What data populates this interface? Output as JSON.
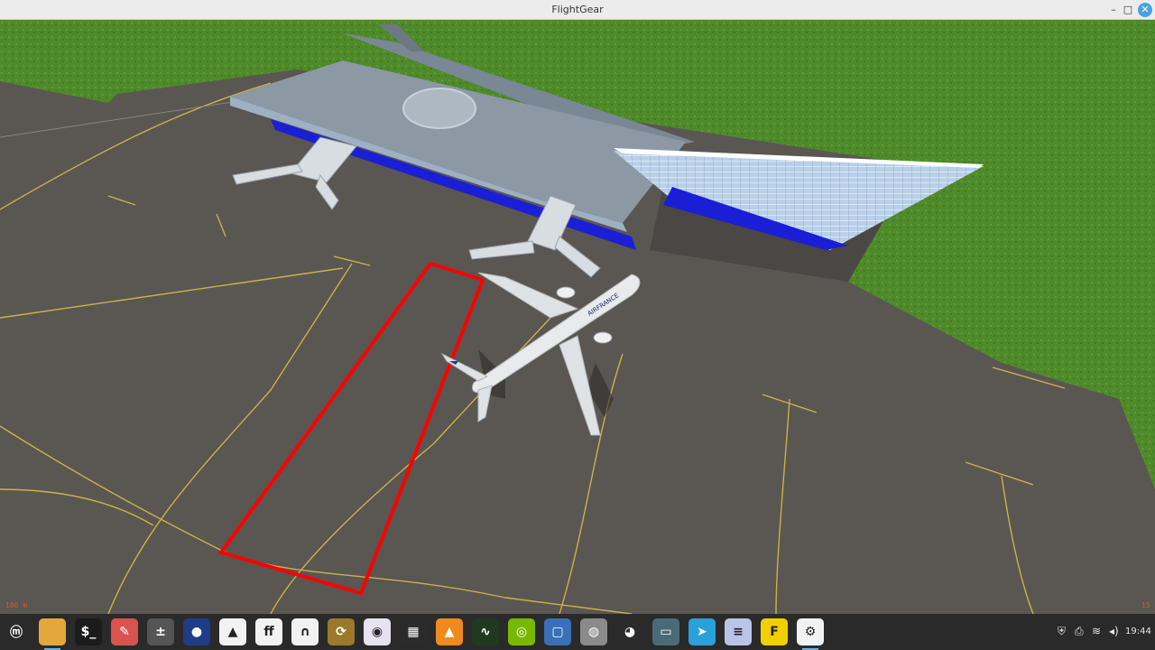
{
  "window": {
    "title": "FlightGear"
  },
  "hud": {
    "bottom_left": "106 m",
    "bottom_right": "15"
  },
  "airliner": {
    "livery": "AIRFRANCE"
  },
  "taskbar": {
    "apps": [
      {
        "name": "menu-icon",
        "glyph": "ⓜ",
        "bg": "#2a2a2a"
      },
      {
        "name": "files-icon",
        "glyph": "",
        "bg": "#e3a73b"
      },
      {
        "name": "terminal-icon",
        "glyph": "$_",
        "bg": "#1b1b1b"
      },
      {
        "name": "gimp-icon",
        "glyph": "✎",
        "bg": "#d9534f"
      },
      {
        "name": "calculator-icon",
        "glyph": "±",
        "bg": "#555555"
      },
      {
        "name": "vpn-icon",
        "glyph": "●",
        "bg": "#1f3c88"
      },
      {
        "name": "inkscape-icon",
        "glyph": "▲",
        "bg": "#f2f2f2"
      },
      {
        "name": "fontforge-icon",
        "glyph": "ff",
        "bg": "#f2f2f2"
      },
      {
        "name": "synaptic-icon",
        "glyph": "∩",
        "bg": "#f2f2f2"
      },
      {
        "name": "update-manager-icon",
        "glyph": "⟳",
        "bg": "#9a7a2a"
      },
      {
        "name": "camera-icon",
        "glyph": "◉",
        "bg": "#e7e2ef"
      },
      {
        "name": "video-editor-icon",
        "glyph": "▦",
        "bg": "#2b2b2b"
      },
      {
        "name": "vlc-icon",
        "glyph": "▲",
        "bg": "#f08a1c"
      },
      {
        "name": "system-monitor-icon",
        "glyph": "∿",
        "bg": "#1f3a1f"
      },
      {
        "name": "nvidia-icon",
        "glyph": "◎",
        "bg": "#76b900"
      },
      {
        "name": "virtualbox-icon",
        "glyph": "▢",
        "bg": "#3a70b8"
      },
      {
        "name": "disks-icon",
        "glyph": "◍",
        "bg": "#8a8a8a"
      },
      {
        "name": "blender-icon",
        "glyph": "◕",
        "bg": "#2a2a2a"
      },
      {
        "name": "display-icon",
        "glyph": "▭",
        "bg": "#4b6a78"
      },
      {
        "name": "telegram-icon",
        "glyph": "➤",
        "bg": "#2aa1da"
      },
      {
        "name": "text-editor-icon",
        "glyph": "≡",
        "bg": "#b9c4e8"
      },
      {
        "name": "flightgear-icon",
        "glyph": "F",
        "bg": "#f0d000"
      },
      {
        "name": "settings-icon",
        "glyph": "⚙",
        "bg": "#f2f2f2"
      }
    ],
    "tray": {
      "clock": "19:44"
    }
  },
  "colors": {
    "grass": "#4f8a2a",
    "apron": "#5a5652",
    "marking": "#c9b24a",
    "highlight": "#ff0000"
  }
}
